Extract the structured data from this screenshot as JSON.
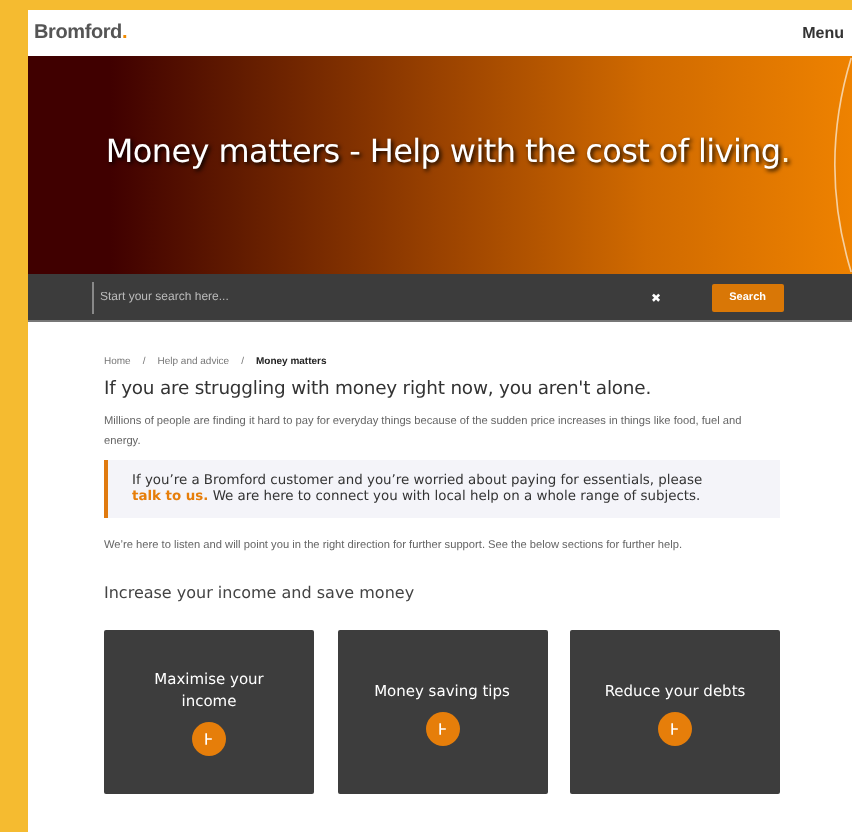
{
  "header": {
    "logo": "Bromford",
    "logo_dot": ".",
    "menu": "Menu"
  },
  "hero": {
    "title": "Money matters - Help with the cost of living",
    "title_dot": "."
  },
  "search": {
    "placeholder": "Start your search here...",
    "clear": "✖",
    "button": "Search"
  },
  "breadcrumbs": [
    {
      "label": "Home",
      "selected": false
    },
    {
      "label": "Help and advice",
      "selected": false
    },
    {
      "label": "Money matters",
      "selected": true
    }
  ],
  "breadcrumb_separator": "/",
  "heading": "If you are struggling with money right now, you aren't alone.",
  "intro": "Millions of people are finding it hard to pay for everyday things because of the sudden price increases in things like food, fuel and energy.",
  "callout": {
    "text": "If you’re a Bromford customer and you’re worried about paying for essentials, please ",
    "link": "talk to us.",
    "text_after": " We are here to connect you with local help on a whole range of subjects."
  },
  "support": "We’re here to listen and will point you in the right direction for further support. See the below sections for further help.",
  "section_title": "Increase your income and save money",
  "cards": [
    {
      "title": "Maximise your income"
    },
    {
      "title": "Money saving tips"
    },
    {
      "title": "Reduce your debts"
    }
  ]
}
